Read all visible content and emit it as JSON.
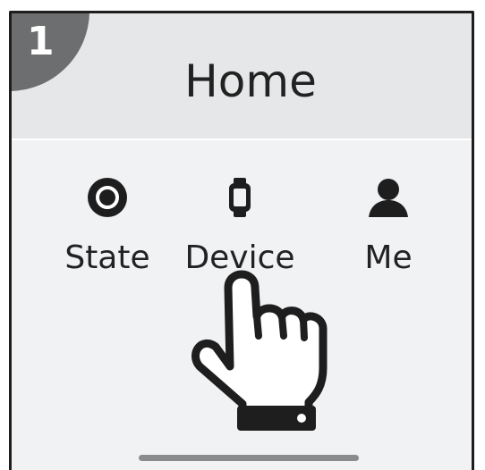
{
  "step": {
    "number": "1"
  },
  "header": {
    "title": "Home"
  },
  "tabs": [
    {
      "label": "State",
      "icon": "state-circle-icon"
    },
    {
      "label": "Device",
      "icon": "watch-icon"
    },
    {
      "label": "Me",
      "icon": "person-icon"
    }
  ],
  "pointer": {
    "icon": "tap-hand-icon",
    "target": "Device"
  },
  "colors": {
    "header_bg": "#e6e7e8",
    "body_bg": "#f1f2f3",
    "badge": "#6d6e70",
    "text": "#222222"
  }
}
